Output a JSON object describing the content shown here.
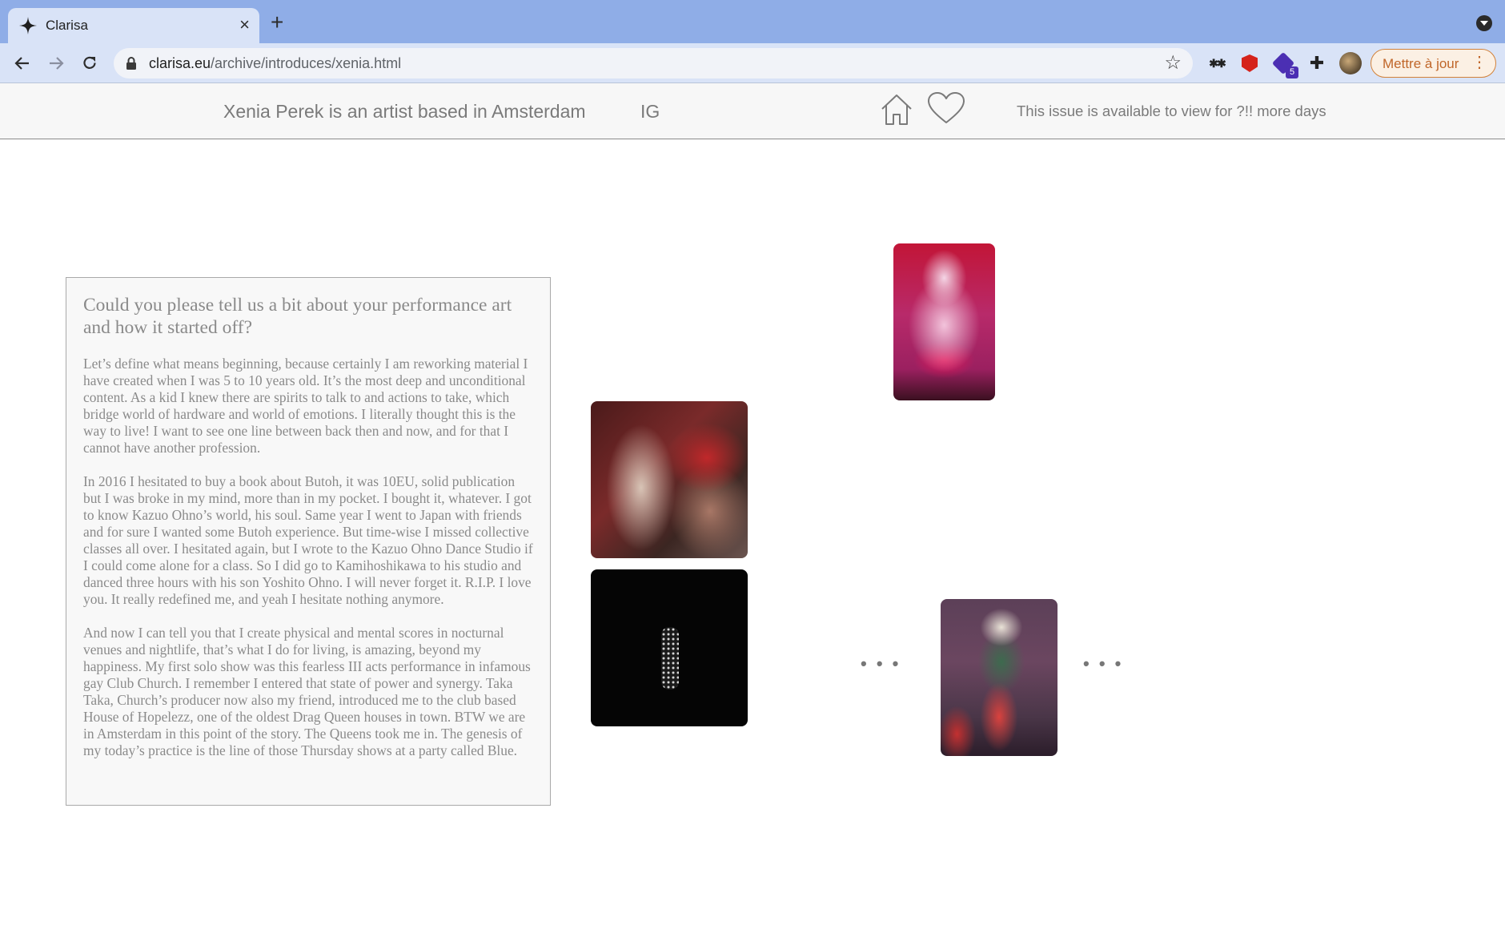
{
  "browser": {
    "tab_title": "Clarisa",
    "tab_close": "×",
    "new_tab": "+",
    "url_host": "clarisa.eu",
    "url_path": "/archive/introduces/xenia.html",
    "extension_badge": "5",
    "update_label": "Mettre à jour",
    "update_menu": "⋮"
  },
  "header": {
    "title": "Xenia Perek is an artist based in Amsterdam",
    "ig_link": "IG",
    "availability": "This issue is available to view for ?!! more days"
  },
  "article": {
    "question": "Could you please tell us a bit about your performance art and how it started off?",
    "paragraphs": [
      "Let’s define what means beginning, because certainly I am reworking material I have created when I was 5 to 10 years old. It’s the most deep and unconditional content. As a kid I knew there are spirits to talk to and actions to take, which bridge world of hardware and world of emotions. I literally thought this is the way to live! I want to see one line between back then and now, and for that I cannot have another profession.",
      "In 2016 I hesitated to buy a book about Butoh, it was 10EU, solid publication but I was broke in my mind, more than in my pocket. I bought it, whatever. I got to know Kazuo Ohno’s world, his soul. Same year I went to Japan with friends and for sure I wanted some Butoh experience. But time-wise I missed collective classes all over. I hesitated again, but I wrote to the Kazuo Ohno Dance Studio if I could come alone for a class. So I did go to Kamihoshikawa to his studio and danced three hours with his son Yoshito Ohno. I will never forget it. R.I.P. I love you. It really redefined me, and yeah I hesitate nothing anymore.",
      "And now I can tell you that I create physical and mental scores in nocturnal venues and nightlife, that’s what I do for living, is amazing, beyond my happiness. My first solo show was this fearless III acts performance in infamous gay Club Church. I remember I entered that state of power and synergy. Taka Taka, Church’s producer now also my friend, introduced me to the club based House of Hopelezz, one of the oldest Drag Queen houses in town. BTW we are in Amsterdam in this point of the story. The Queens took me in. The genesis of my today’s practice is the line of those Thursday shows at a party called Blue."
    ]
  },
  "gallery": {
    "more_left": "• • •",
    "more_right": "• • •"
  },
  "icons": {
    "back": "arrow-left-icon",
    "forward": "arrow-right-icon",
    "reload": "reload-icon",
    "lock": "lock-icon",
    "bookmark": "star-icon",
    "home": "home-icon",
    "favorite": "heart-icon"
  },
  "colors": {
    "tabbar": "#8fade7",
    "toolbar": "#d9e3f7",
    "update_accent": "#c0662a",
    "header_text": "#7a7a7a",
    "card_border": "#a9a9a9"
  }
}
